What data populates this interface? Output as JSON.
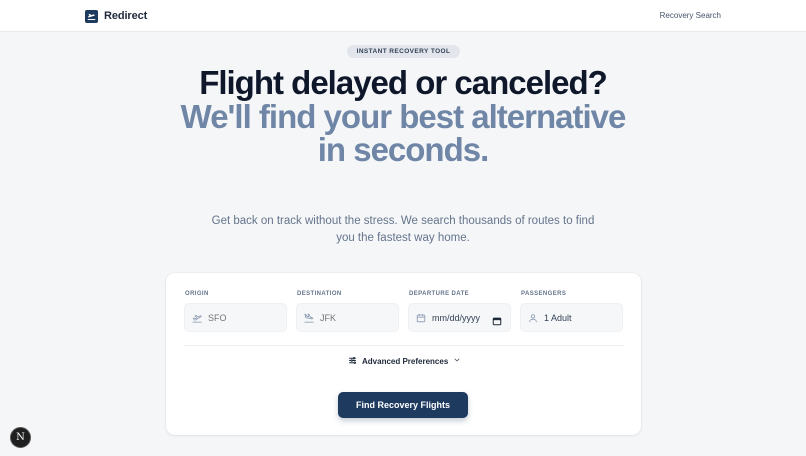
{
  "header": {
    "brand": "Redirect",
    "nav_link": "Recovery Search"
  },
  "hero": {
    "badge": "INSTANT RECOVERY TOOL",
    "headline_dark": "Flight delayed or canceled?",
    "headline_accent": "We'll find your best alternative in seconds.",
    "subtitle": "Get back on track without the stress. We search thousands of routes to find you the fastest way home."
  },
  "form": {
    "origin": {
      "label": "ORIGIN",
      "placeholder": "SFO",
      "icon": "plane-takeoff-icon"
    },
    "destination": {
      "label": "DESTINATION",
      "placeholder": "JFK",
      "icon": "plane-landing-icon"
    },
    "date": {
      "label": "DEPARTURE DATE",
      "value": "mm/dd/yyyy",
      "icon": "calendar-icon"
    },
    "passengers": {
      "label": "PASSENGERS",
      "value": "1 Adult",
      "icon": "user-icon"
    },
    "advanced_label": "Advanced Preferences",
    "submit_label": "Find Recovery Flights"
  },
  "overlay": {
    "badge_letter": "N"
  },
  "colors": {
    "primary": "#1e3a5f",
    "accent_text": "#6f86a6",
    "background": "#f5f6f8"
  }
}
